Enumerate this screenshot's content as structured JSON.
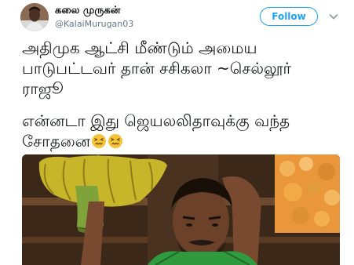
{
  "author": {
    "display_name": "கலை முருகன்",
    "handle": "@KalaiMurugan03"
  },
  "follow_button": {
    "label": "Follow",
    "color": "#1da1f2"
  },
  "menu_icon": "chevron-down-icon",
  "tweet": {
    "lines": [
      "அதிமுக ஆட்சி மீண்டும் அமைய",
      "பாடுபட்டவர் தான் சசிகலா ~செல்லூர்",
      "ராஜூ",
      "என்னடா இது ஜெயலலிதாவுக்கு வந்த",
      "சோதனை"
    ],
    "emoji": [
      "confounded-face-icon",
      "confounded-face-icon"
    ]
  },
  "media": {
    "type": "photo"
  }
}
